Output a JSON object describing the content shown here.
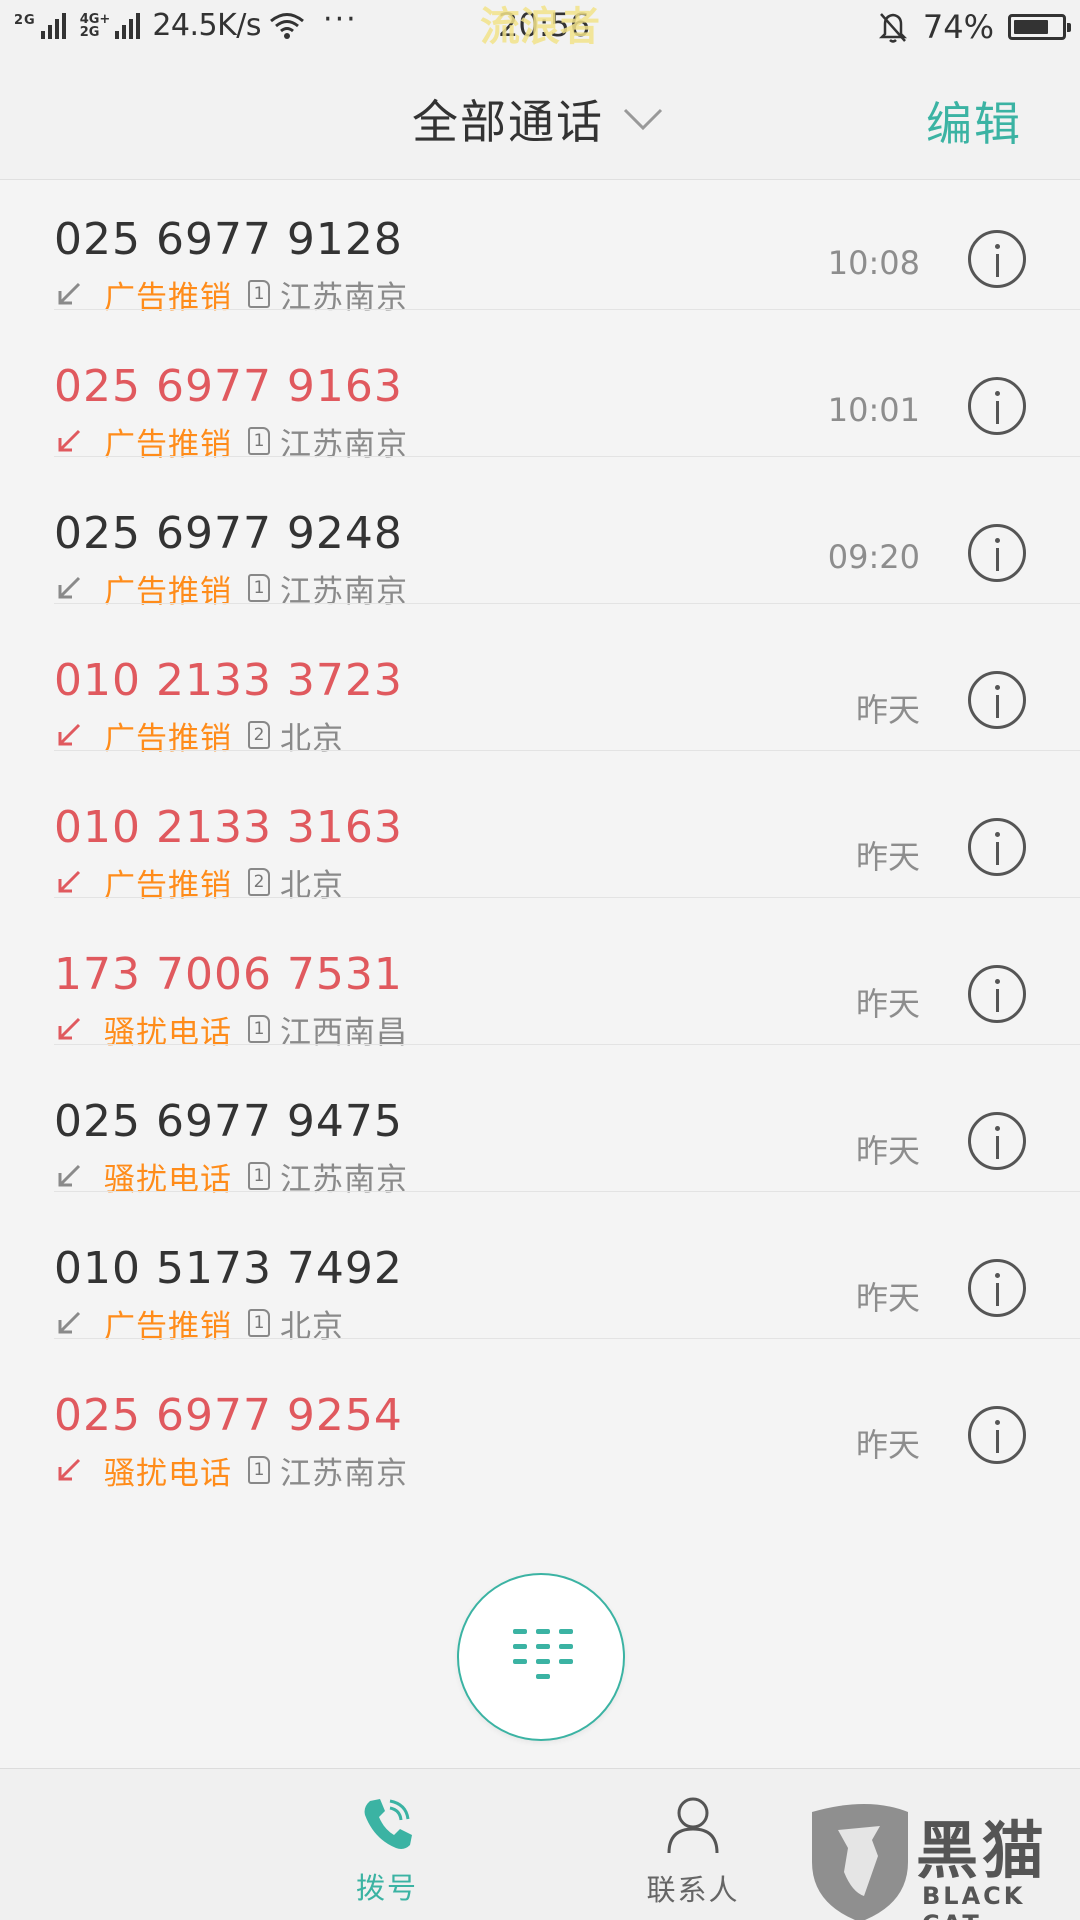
{
  "status_bar": {
    "network_1": "2G",
    "network_2_top": "4G+",
    "network_2_bottom": "2G",
    "speed": "24.5K/s",
    "more": "···",
    "time": "20:56",
    "watermark": "流浪者",
    "battery_percent": "74%",
    "battery_level": 0.74
  },
  "header": {
    "title": "全部通话",
    "edit_label": "编辑"
  },
  "colors": {
    "accent": "#3bb3a3",
    "missed": "#e0595e",
    "tag": "#ff8c1a",
    "normal": "#333333"
  },
  "calls": [
    {
      "number": "025 6977 9128",
      "missed": false,
      "tag": "广告推销",
      "sim": "1",
      "location": "江苏南京",
      "time": "10:08"
    },
    {
      "number": "025 6977 9163",
      "missed": true,
      "tag": "广告推销",
      "sim": "1",
      "location": "江苏南京",
      "time": "10:01"
    },
    {
      "number": "025 6977 9248",
      "missed": false,
      "tag": "广告推销",
      "sim": "1",
      "location": "江苏南京",
      "time": "09:20"
    },
    {
      "number": "010 2133 3723",
      "missed": true,
      "tag": "广告推销",
      "sim": "2",
      "location": "北京",
      "time": "昨天"
    },
    {
      "number": "010 2133 3163",
      "missed": true,
      "tag": "广告推销",
      "sim": "2",
      "location": "北京",
      "time": "昨天"
    },
    {
      "number": "173 7006 7531",
      "missed": true,
      "tag": "骚扰电话",
      "sim": "1",
      "location": "江西南昌",
      "time": "昨天"
    },
    {
      "number": "025 6977 9475",
      "missed": false,
      "tag": "骚扰电话",
      "sim": "1",
      "location": "江苏南京",
      "time": "昨天"
    },
    {
      "number": "010 5173 7492",
      "missed": false,
      "tag": "广告推销",
      "sim": "1",
      "location": "北京",
      "time": "昨天"
    },
    {
      "number": "025 6977 9254",
      "missed": true,
      "tag": "骚扰电话",
      "sim": "1",
      "location": "江苏南京",
      "time": "昨天"
    }
  ],
  "bottom_nav": {
    "dial_label": "拨号",
    "contacts_label": "联系人",
    "dial_icon": "phone-icon",
    "contacts_icon": "person-icon",
    "fab_icon": "dialpad-icon"
  },
  "watermark_brand": {
    "title": "黑猫",
    "subtitle": "BLACK CAT"
  }
}
